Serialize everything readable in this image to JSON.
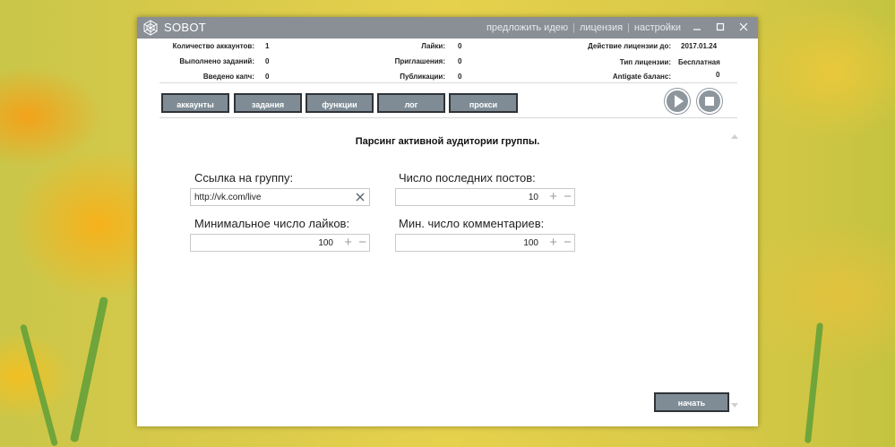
{
  "app": {
    "title": "SOBOT",
    "links": [
      "предложить идею",
      "лицензия",
      "настройки"
    ]
  },
  "stats": {
    "accounts_label": "Количество аккаунтов:",
    "accounts_value": "1",
    "tasks_label": "Выполнено заданий:",
    "tasks_value": "0",
    "captcha_label": "Введено капч:",
    "captcha_value": "0",
    "likes_label": "Лайки:",
    "likes_value": "0",
    "invites_label": "Приглашения:",
    "invites_value": "0",
    "posts_label": "Публикации:",
    "posts_value": "0",
    "license_until_label": "Действие лицензии до:",
    "license_until_value": "2017.01.24",
    "license_type_label": "Тип лицензии:",
    "license_type_value": "Бесплатная",
    "antigate_label": "Antigate баланс:",
    "antigate_value": "0"
  },
  "tabs": [
    "аккаунты",
    "задания",
    "функции",
    "лог",
    "прокси"
  ],
  "main": {
    "title": "Парсинг активной аудитории группы.",
    "group_link_label": "Ссылка на группу:",
    "group_link_value": "http://vk.com/live",
    "last_posts_label": "Число последних постов:",
    "last_posts_value": "10",
    "min_likes_label": "Минимальное число лайков:",
    "min_likes_value": "100",
    "min_comments_label": "Мин. число комментариев:",
    "min_comments_value": "100",
    "start_label": "начать"
  },
  "icons": {
    "play": "play-icon",
    "stop": "stop-icon",
    "clear": "close-icon",
    "plus": "plus-icon",
    "minus": "minus-icon"
  }
}
